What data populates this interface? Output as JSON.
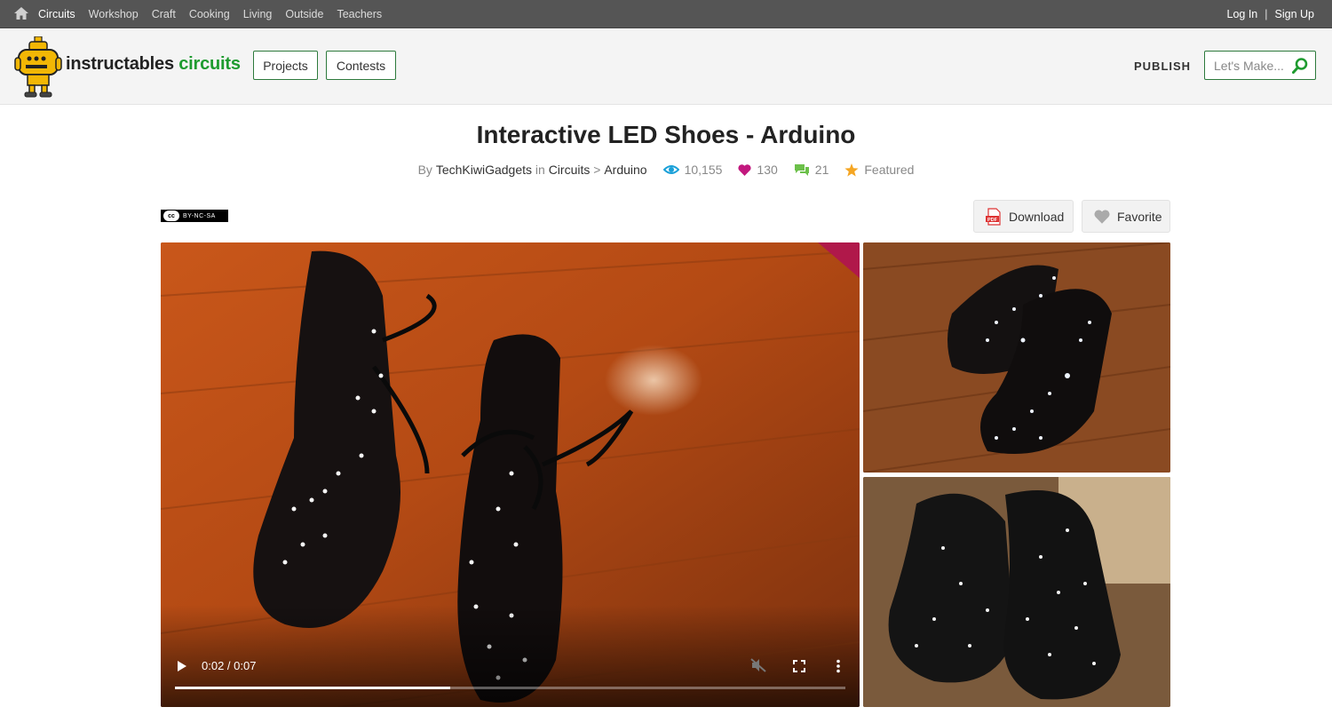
{
  "topnav": {
    "categories": [
      "Circuits",
      "Workshop",
      "Craft",
      "Cooking",
      "Living",
      "Outside",
      "Teachers"
    ],
    "login": "Log In",
    "separator": "|",
    "signup": "Sign Up"
  },
  "header": {
    "brand": "instructables",
    "brand_accent": "circuits",
    "projects": "Projects",
    "contests": "Contests",
    "publish": "PUBLISH",
    "search_placeholder": "Let's Make..."
  },
  "project": {
    "title": "Interactive LED Shoes - Arduino",
    "by": "By",
    "author": "TechKiwiGadgets",
    "in": "in",
    "category": "Circuits",
    "crumb_sep": ">",
    "subcategory": "Arduino",
    "views": "10,155",
    "favorites": "130",
    "comments": "21",
    "featured": "Featured",
    "license": "BY-NC-SA",
    "license_cc": "cc",
    "download": "Download",
    "favorite": "Favorite"
  },
  "video": {
    "time": "0:02 / 0:07",
    "progress": 0.41
  },
  "colors": {
    "accent_green": "#1e9b2f",
    "views_blue": "#1aa0d8",
    "heart_pink": "#c2187e",
    "comment_green": "#6cc04a",
    "star_orange": "#f5a623"
  }
}
